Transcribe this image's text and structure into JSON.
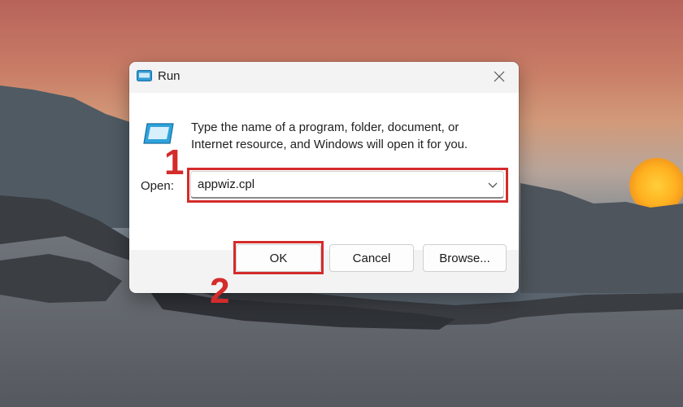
{
  "dialog": {
    "title": "Run",
    "description": "Type the name of a program, folder, document, or Internet resource, and Windows will open it for you.",
    "open_label": "Open:",
    "open_value": "appwiz.cpl"
  },
  "buttons": {
    "ok": "OK",
    "cancel": "Cancel",
    "browse": "Browse..."
  },
  "annotations": {
    "step1": "1",
    "step2": "2",
    "highlight_color": "#d42b2b"
  },
  "icons": [
    "run-icon",
    "close-icon",
    "chevron-down-icon"
  ]
}
